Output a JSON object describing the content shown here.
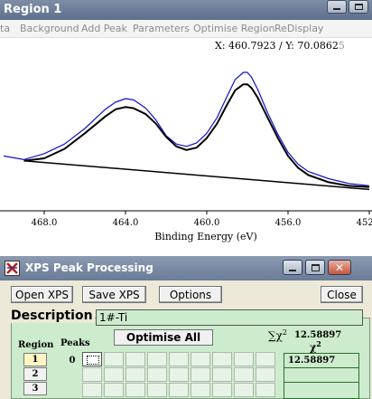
{
  "region_window": {
    "title": "Region 1",
    "menu": [
      "ta",
      "Background",
      "Add Peak",
      "Parameters",
      "Optimise Region",
      "ReDisplay"
    ],
    "cursor_readout": "X: 460.7923 / Y: 70.0862",
    "cursor_readout_tail": "5"
  },
  "chart_data": {
    "type": "line",
    "xlabel": "Binding Energy (eV)",
    "x_ticks": [
      "468.0",
      "464.0",
      "460.0",
      "456.0",
      "452.0"
    ],
    "xlim": [
      470.0,
      452.0
    ],
    "x_reversed": true,
    "y_axis_shown": false,
    "series": [
      {
        "color": "#1010d0",
        "x": [
          470.0,
          469.0,
          468.0,
          467.0,
          466.0,
          465.0,
          464.5,
          464.0,
          463.6,
          463.0,
          462.5,
          462.0,
          461.5,
          461.0,
          460.5,
          460.0,
          459.5,
          459.0,
          458.6,
          458.2,
          458.0,
          457.8,
          457.5,
          457.0,
          456.5,
          456.0,
          455.5,
          455.0,
          454.0,
          453.0,
          452.0
        ],
        "y": [
          0.3,
          0.27,
          0.32,
          0.4,
          0.53,
          0.69,
          0.75,
          0.78,
          0.77,
          0.7,
          0.6,
          0.47,
          0.4,
          0.38,
          0.41,
          0.49,
          0.62,
          0.8,
          0.94,
          1.0,
          1.0,
          0.96,
          0.86,
          0.66,
          0.48,
          0.33,
          0.23,
          0.17,
          0.11,
          0.07,
          0.05
        ]
      },
      {
        "color": "#000000",
        "x": [
          469.0,
          468.0,
          467.0,
          466.0,
          465.0,
          464.5,
          464.0,
          463.6,
          463.0,
          462.5,
          462.0,
          461.5,
          461.0,
          460.5,
          460.0,
          459.5,
          459.0,
          458.6,
          458.2,
          458.0,
          457.8,
          457.5,
          457.0,
          456.5,
          456.0,
          455.5,
          455.0,
          454.0,
          453.0,
          452.0
        ],
        "y": [
          0.26,
          0.28,
          0.36,
          0.49,
          0.63,
          0.69,
          0.71,
          0.7,
          0.65,
          0.57,
          0.46,
          0.38,
          0.35,
          0.37,
          0.45,
          0.57,
          0.73,
          0.85,
          0.9,
          0.9,
          0.87,
          0.79,
          0.62,
          0.45,
          0.3,
          0.2,
          0.14,
          0.08,
          0.05,
          0.04
        ]
      },
      {
        "color": "#000000",
        "x": [
          469.0,
          452.0
        ],
        "y": [
          0.26,
          0.02
        ]
      }
    ]
  },
  "xps_window": {
    "title": "XPS Peak Processing",
    "buttons": {
      "open": "Open XPS",
      "save": "Save XPS",
      "options": "Options",
      "close": "Close"
    },
    "description_label": "Description",
    "description_value": "1#-Ti",
    "chi_label": "∑χ",
    "chi_sup": "2",
    "chi_value": "12.58897",
    "chi_symbol": "χ",
    "chi_symbol_sup": "2",
    "chi_list_value": "12.58897",
    "region_header": "Region",
    "peaks_header": "Peaks",
    "optimise_all": "Optimise All",
    "regions": [
      "1",
      "2",
      "3"
    ],
    "peak_count": "0"
  }
}
